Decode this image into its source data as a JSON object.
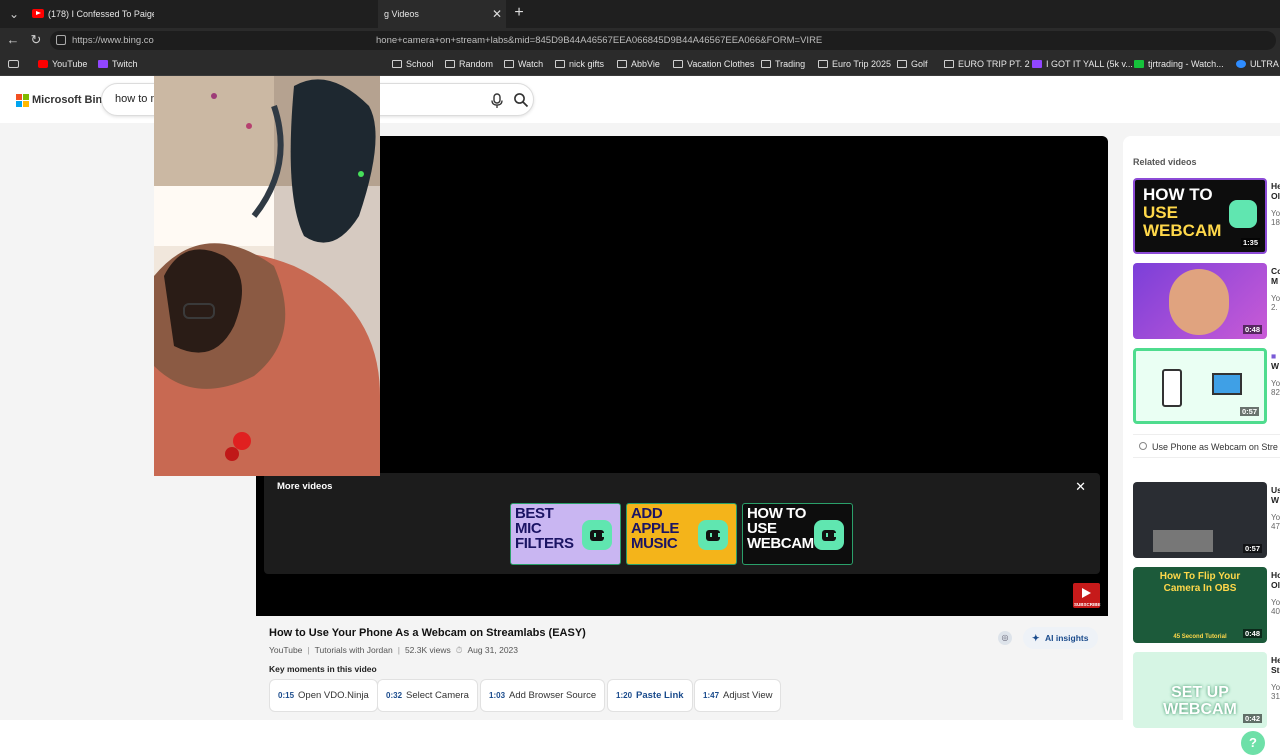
{
  "browser": {
    "tabs": [
      {
        "label": "(178) I Confessed To Paige... -",
        "icon": "youtube-icon"
      },
      {
        "label": "g Videos",
        "icon": ""
      }
    ],
    "address": {
      "url_left": "https://www.bing.co",
      "url_right": "hone+camera+on+stream+labs&mid=845D9B44A46567EEA066845D9B44A46567EEA066&FORM=VIRE"
    },
    "bookmarks": [
      {
        "label": "YouTube",
        "icon": "youtube-icon"
      },
      {
        "label": "Twitch",
        "icon": "twitch-icon"
      },
      {
        "label": "School",
        "icon": "folder-icon"
      },
      {
        "label": "Random",
        "icon": "folder-icon"
      },
      {
        "label": "Watch",
        "icon": "folder-icon"
      },
      {
        "label": "nick gifts",
        "icon": "folder-icon"
      },
      {
        "label": "AbbVie",
        "icon": "folder-icon"
      },
      {
        "label": "Vacation Clothes",
        "icon": "folder-icon"
      },
      {
        "label": "Trading",
        "icon": "folder-icon"
      },
      {
        "label": "Euro Trip 2025",
        "icon": "folder-icon"
      },
      {
        "label": "Golf",
        "icon": "folder-icon"
      },
      {
        "label": "EURO TRIP PT. 2",
        "icon": "folder-icon"
      },
      {
        "label": "I GOT IT YALL (5k v...",
        "icon": "twitch-icon"
      },
      {
        "label": "tjrtrading - Watch...",
        "icon": "kick-icon"
      },
      {
        "label": "ULTRA",
        "icon": "ultra-icon"
      }
    ]
  },
  "bing": {
    "logo_text": "Microsoft Bing",
    "search_value": "how to m",
    "brand_colors": [
      "#f25022",
      "#7fba00",
      "#00a4ef",
      "#ffb900"
    ]
  },
  "player": {
    "more_videos_title": "More videos",
    "thumbs": [
      {
        "lines": [
          "BEST",
          "MIC",
          "FILTERS"
        ],
        "bg": "#c9b6f2",
        "text_color": "#1b1464"
      },
      {
        "lines": [
          "ADD",
          "APPLE",
          "MUSIC"
        ],
        "bg": "#f4b41a",
        "text_color": "#1b1464"
      },
      {
        "lines": [
          "HOW TO",
          "USE",
          "WEBCAM"
        ],
        "bg": "#0d0d0d",
        "text_color": "#ffffff"
      }
    ],
    "subscribe_label": "SUBSCRIBE"
  },
  "video": {
    "title": "How to Use Your Phone As a Webcam on Streamlabs (EASY)",
    "source": "YouTube",
    "channel": "Tutorials with Jordan",
    "views": "52.3K views",
    "date": "Aug 31, 2023",
    "ai_insights_label": "AI insights",
    "key_moments_title": "Key moments in this video",
    "moments": [
      {
        "time": "0:15",
        "label": "Open VDO.Ninja"
      },
      {
        "time": "0:32",
        "label": "Select Camera"
      },
      {
        "time": "1:03",
        "label": "Add Browser Source"
      },
      {
        "time": "1:20",
        "label": "Paste Link"
      },
      {
        "time": "1:47",
        "label": "Adjust View"
      }
    ]
  },
  "related": {
    "title": "Related videos",
    "search_suggestion": "Use Phone as Webcam on Stre",
    "items": [
      {
        "duration": "1:35",
        "title_lines": [
          "He",
          "Ol"
        ],
        "sub_lines": [
          "Yo",
          "18"
        ],
        "thumb_text": [
          "HOW TO",
          "USE",
          "WEBCAM"
        ]
      },
      {
        "duration": "0:48",
        "title_lines": [
          "Co",
          "M"
        ],
        "sub_lines": [
          "Yo",
          "2."
        ],
        "thumb_text": []
      },
      {
        "duration": "0:57",
        "title_lines": [
          "W"
        ],
        "sub_lines": [
          "Yo",
          "82"
        ],
        "thumb_text": []
      },
      {
        "duration": "0:57",
        "title_lines": [
          "Us",
          "W"
        ],
        "sub_lines": [
          "Yo",
          "47"
        ],
        "thumb_text": []
      },
      {
        "duration": "0:48",
        "title_lines": [
          "Ho",
          "Ol"
        ],
        "sub_lines": [
          "Yo",
          "40"
        ],
        "thumb_text": [
          "How To Flip Your",
          "Camera In OBS",
          "45 Second Tutorial"
        ]
      },
      {
        "duration": "0:42",
        "title_lines": [
          "He",
          "St"
        ],
        "sub_lines": [
          "Yo",
          "31"
        ],
        "thumb_text": [
          "SET UP",
          "WEBCAM"
        ]
      }
    ]
  }
}
